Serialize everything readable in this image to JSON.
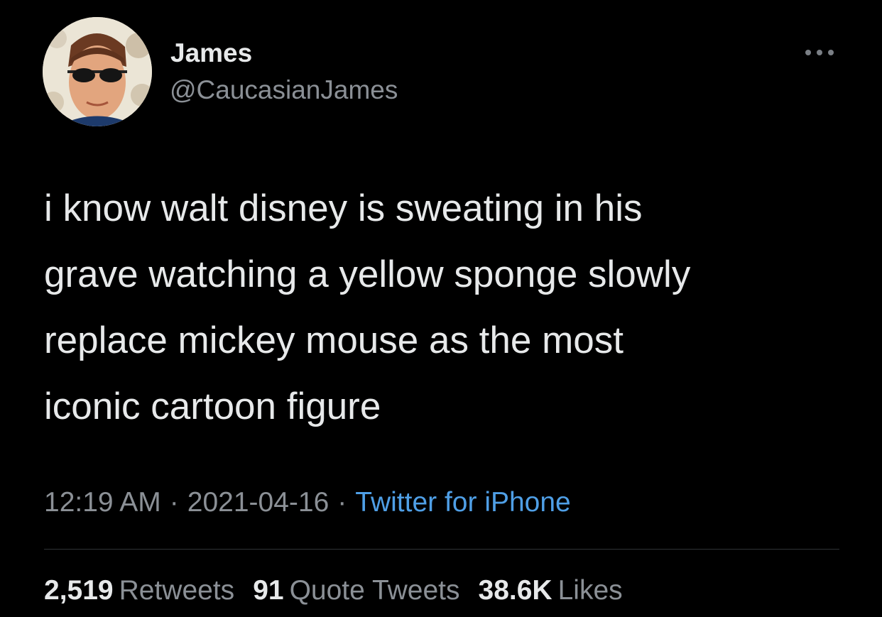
{
  "user": {
    "name": "James",
    "handle": "@CaucasianJames",
    "avatar_icon": "profile-photo-man-sunglasses"
  },
  "tweet": {
    "text_lines": [
      "i know walt disney is sweating in his",
      "grave watching a yellow sponge slowly",
      "replace mickey mouse as the most",
      "iconic cartoon figure"
    ],
    "time": "12:19 AM",
    "date": "2021-04-16",
    "separator": "·",
    "source": "Twitter for iPhone"
  },
  "stats": {
    "retweets_count": "2,519",
    "retweets_label": "Retweets",
    "quotes_count": "91",
    "quotes_label": "Quote Tweets",
    "likes_count": "38.6K",
    "likes_label": "Likes"
  },
  "colors": {
    "background": "#000000",
    "primary_text": "#e7e9ea",
    "secondary_text": "#8b9096",
    "link": "#4f9fe6",
    "divider": "#2f3336"
  }
}
